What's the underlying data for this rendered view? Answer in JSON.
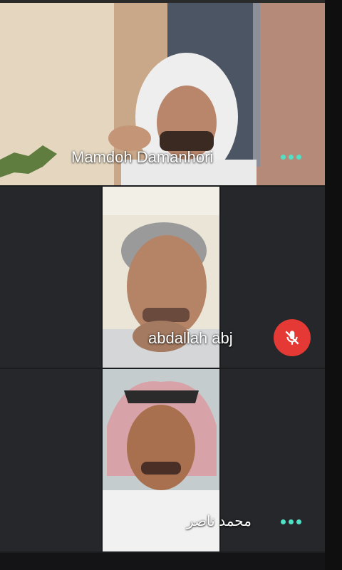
{
  "participants": [
    {
      "name": "Mamdoh Damanhori",
      "status_icon": "more-dots-icon"
    },
    {
      "name": "abdallah abj",
      "status_icon": "mic-off-icon"
    },
    {
      "name": "محمد ناصر",
      "status_icon": "more-dots-icon"
    }
  ],
  "colors": {
    "background": "#1b1c1e",
    "tile_border": "#26272a",
    "mute_red": "#e53935",
    "dots_teal": "#4fe0c6",
    "label_text": "#ffffff"
  }
}
